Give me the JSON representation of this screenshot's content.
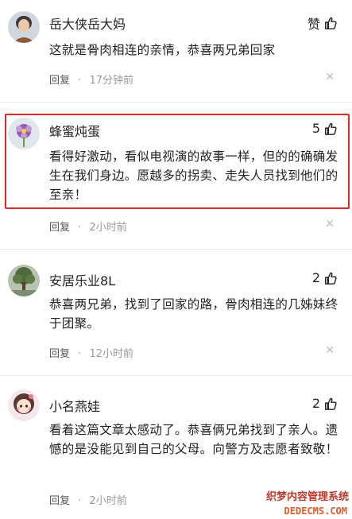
{
  "comments": [
    {
      "author": "岳大侠岳大妈",
      "likes": "赞",
      "text": "这就是骨肉相连的亲情，恭喜两兄弟回家",
      "reply_label": "回复",
      "time": "17分钟前",
      "avatar_icon": "elderly-woman-avatar"
    },
    {
      "author": "蜂蜜炖蛋",
      "likes": "5",
      "text": "看得好激动，看似电视演的故事一样，但的的确确发生在我们身边。愿越多的拐卖、走失人员找到他们的至亲！",
      "reply_label": "回复",
      "time": "2小时前",
      "avatar_icon": "flower-avatar",
      "highlighted": true
    },
    {
      "author": "安居乐业8L",
      "likes": "2",
      "text": "恭喜两兄弟，找到了回家的路，骨肉相连的几姊妹终于团聚。",
      "reply_label": "回复",
      "time": "12小时前",
      "avatar_icon": "tree-avatar"
    },
    {
      "author": "小名燕娃",
      "likes": "2",
      "text": "看着这篇文章太感动了。恭喜俩兄弟找到了亲人。遗憾的是没能见到自己的父母。向警方及志愿者致敬！",
      "reply_label": "回复",
      "time": "2小时前",
      "avatar_icon": "cartoon-girl-avatar"
    }
  ],
  "separator": "·",
  "watermark": {
    "line1": "织梦内容管理系统",
    "line2": "DEDECMS.COM"
  },
  "colors": {
    "highlight_border": "#e0282b",
    "meta_text": "#999999"
  }
}
